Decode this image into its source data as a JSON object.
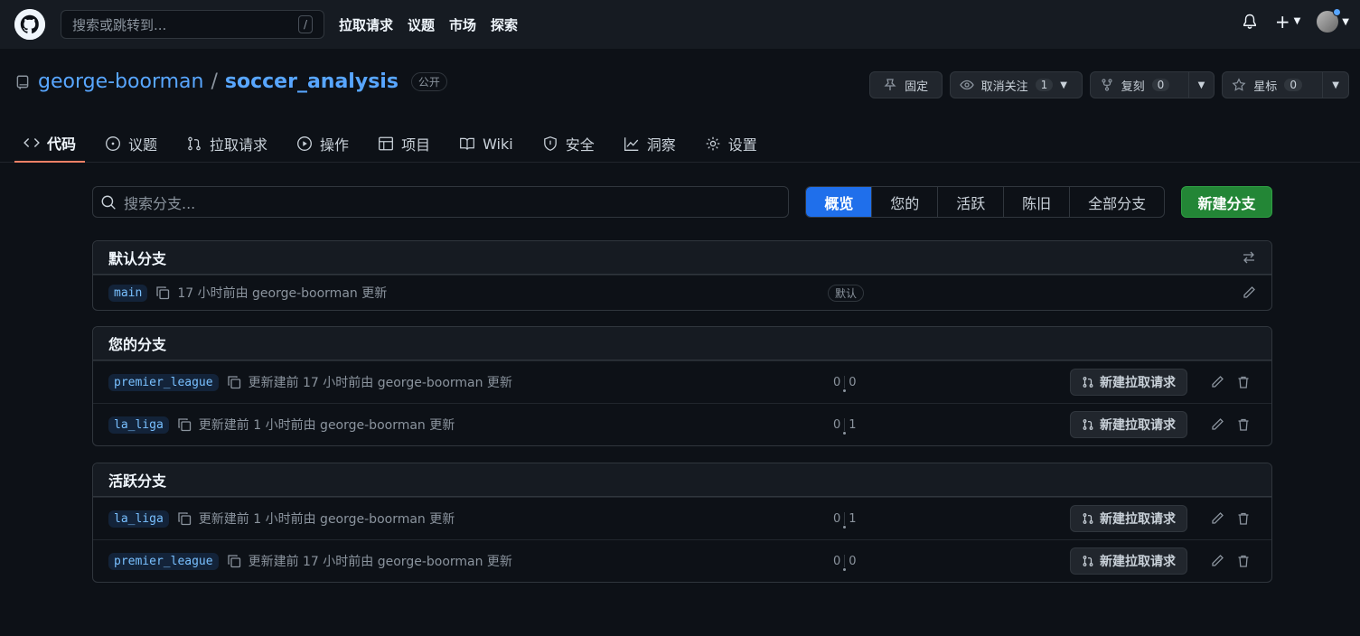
{
  "header": {
    "search_placeholder": "搜索或跳转到...",
    "slash_key": "/",
    "nav": [
      "拉取请求",
      "议题",
      "市场",
      "探索"
    ]
  },
  "repo": {
    "owner": "george-boorman",
    "separator": "/",
    "name": "soccer_analysis",
    "visibility": "公开",
    "actions": {
      "pin": "固定",
      "watch": "取消关注",
      "watch_count": "1",
      "fork": "复刻",
      "fork_count": "0",
      "star": "星标",
      "star_count": "0"
    },
    "tabs": [
      {
        "label": "代码",
        "icon": "code-icon",
        "active": true
      },
      {
        "label": "议题",
        "icon": "issue-icon"
      },
      {
        "label": "拉取请求",
        "icon": "pull-request-icon"
      },
      {
        "label": "操作",
        "icon": "play-icon"
      },
      {
        "label": "项目",
        "icon": "table-icon"
      },
      {
        "label": "Wiki",
        "icon": "book-icon"
      },
      {
        "label": "安全",
        "icon": "shield-icon"
      },
      {
        "label": "洞察",
        "icon": "graph-icon"
      },
      {
        "label": "设置",
        "icon": "gear-icon"
      }
    ]
  },
  "branches_page": {
    "search_placeholder": "搜索分支...",
    "filters": [
      "概览",
      "您的",
      "活跃",
      "陈旧",
      "全部分支"
    ],
    "active_filter": "概览",
    "new_branch": "新建分支",
    "new_pr_label": "新建拉取请求",
    "sections": {
      "default": {
        "title": "默认分支",
        "rows": [
          {
            "branch": "main",
            "meta": "17 小时前由 george-boorman 更新",
            "label": "默认"
          }
        ]
      },
      "yours": {
        "title": "您的分支",
        "rows": [
          {
            "branch": "premier_league",
            "meta": "更新建前 17 小时前由 george-boorman 更新",
            "behind": "0",
            "ahead": "0"
          },
          {
            "branch": "la_liga",
            "meta": "更新建前 1 小时前由 george-boorman 更新",
            "behind": "0",
            "ahead": "1"
          }
        ]
      },
      "active": {
        "title": "活跃分支",
        "rows": [
          {
            "branch": "la_liga",
            "meta": "更新建前 1 小时前由 george-boorman 更新",
            "behind": "0",
            "ahead": "1"
          },
          {
            "branch": "premier_league",
            "meta": "更新建前 17 小时前由 george-boorman 更新",
            "behind": "0",
            "ahead": "0"
          }
        ]
      }
    }
  }
}
